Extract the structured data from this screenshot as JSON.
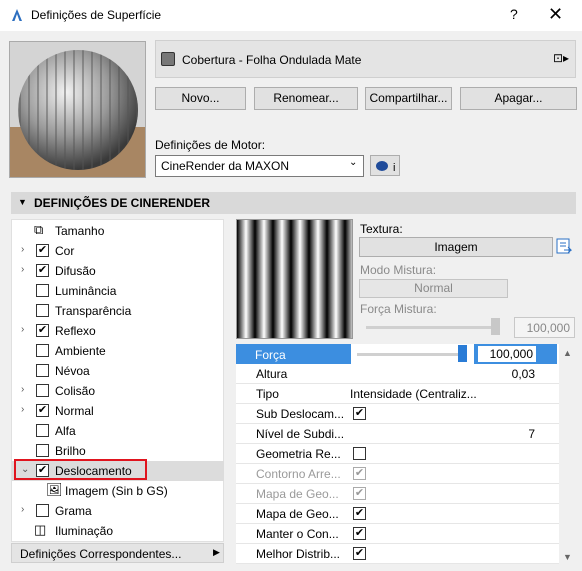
{
  "window": {
    "title": "Definições de Superfície",
    "help": "?",
    "close": "✕"
  },
  "surface": {
    "name": "Cobertura - Folha Ondulada Mate",
    "menu": "⊡▸"
  },
  "buttons": {
    "new": "Novo...",
    "rename": "Renomear...",
    "share": "Compartilhar...",
    "delete": "Apagar..."
  },
  "engine": {
    "label": "Definições de Motor:",
    "value": "CineRender da MAXON",
    "info": "i"
  },
  "section": {
    "title": "DEFINIÇÕES DE CINERENDER"
  },
  "tree": [
    {
      "label": "Tamanho",
      "type": "icon",
      "icon": "size-icon"
    },
    {
      "label": "Cor",
      "type": "check",
      "checked": true,
      "expand": true
    },
    {
      "label": "Difusão",
      "type": "check",
      "checked": true,
      "expand": true
    },
    {
      "label": "Luminância",
      "type": "check",
      "checked": false
    },
    {
      "label": "Transparência",
      "type": "check",
      "checked": false
    },
    {
      "label": "Reflexo",
      "type": "check",
      "checked": true,
      "expand": true
    },
    {
      "label": "Ambiente",
      "type": "check",
      "checked": false
    },
    {
      "label": "Névoa",
      "type": "check",
      "checked": false
    },
    {
      "label": "Colisão",
      "type": "check",
      "checked": false,
      "expand": true
    },
    {
      "label": "Normal",
      "type": "check",
      "checked": true,
      "expand": true
    },
    {
      "label": "Alfa",
      "type": "check",
      "checked": false
    },
    {
      "label": "Brilho",
      "type": "check",
      "checked": false
    },
    {
      "label": "Deslocamento",
      "type": "check",
      "checked": true,
      "expanded": true
    },
    {
      "label": "Imagem (Sin b GS)",
      "type": "image"
    },
    {
      "label": "Grama",
      "type": "check",
      "checked": false,
      "expand": true
    },
    {
      "label": "Iluminação",
      "type": "icon",
      "icon": "lighting-icon"
    }
  ],
  "footer": {
    "label": "Definições Correspondentes..."
  },
  "texture": {
    "label": "Textura:",
    "button": "Imagem",
    "mix_mode_label": "Modo Mistura:",
    "mix_mode": "Normal",
    "mix_force_label": "Força Mistura:",
    "mix_force": "100,000"
  },
  "props": {
    "forca": {
      "label": "Força",
      "value": "100,000"
    },
    "rows": [
      {
        "label": "Altura",
        "value": "0,03",
        "kind": "right"
      },
      {
        "label": "Tipo",
        "value": "Intensidade (Centraliz...",
        "kind": "text"
      },
      {
        "label": "Sub Deslocam...",
        "kind": "check",
        "checked": true
      },
      {
        "label": "Nível de Subdi...",
        "value": "7",
        "kind": "right"
      },
      {
        "label": "Geometria Re...",
        "kind": "check",
        "checked": false
      },
      {
        "label": "Contorno Arre...",
        "kind": "check",
        "checked": true,
        "disabled": true
      },
      {
        "label": "Mapa de Geo...",
        "kind": "check",
        "checked": true,
        "disabled": true
      },
      {
        "label": "Mapa de Geo...",
        "kind": "check",
        "checked": true
      },
      {
        "label": "Manter o Con...",
        "kind": "check",
        "checked": true
      },
      {
        "label": "Melhor Distrib...",
        "kind": "check",
        "checked": true
      }
    ]
  }
}
